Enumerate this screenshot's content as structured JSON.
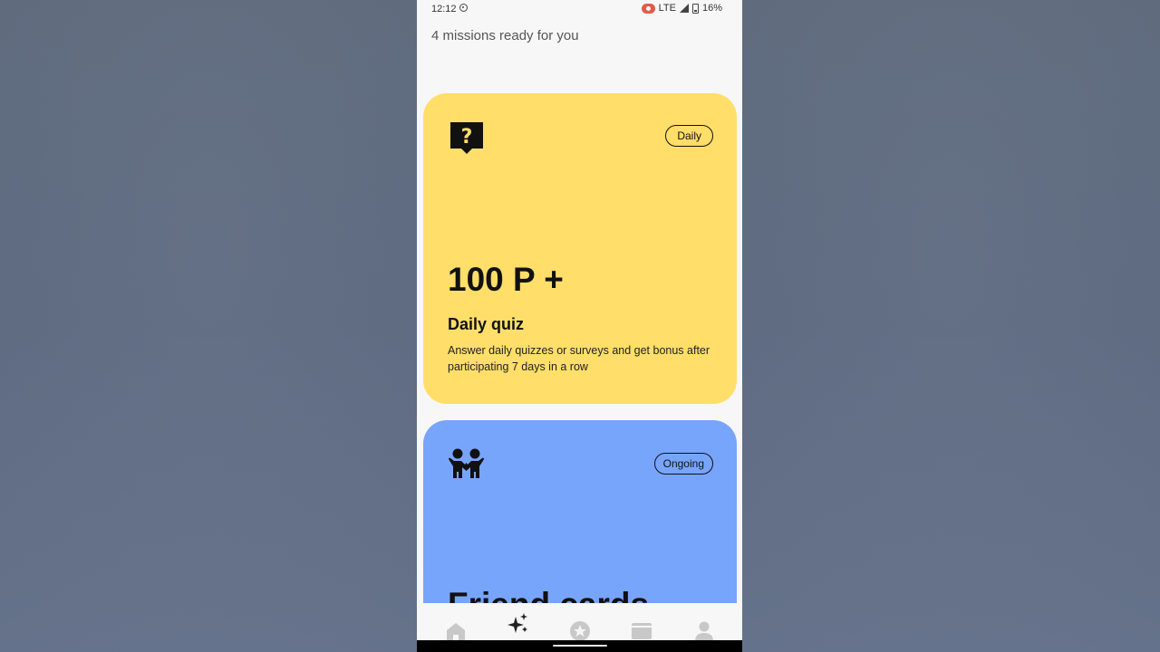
{
  "status_bar": {
    "time": "12:12",
    "network": "LTE",
    "battery": "16%"
  },
  "header": {
    "subtitle": "4 missions ready for you"
  },
  "missions": [
    {
      "badge": "Daily",
      "points": "100 P +",
      "title": "Daily quiz",
      "description": "Answer daily quizzes or surveys and get bonus after participating 7 days in a row",
      "icon": "quiz-question-icon",
      "color": "#ffde69"
    },
    {
      "badge": "Ongoing",
      "title": "Friend cards",
      "icon": "friends-icon",
      "color": "#78a5fc"
    }
  ],
  "bottom_nav": {
    "items": [
      {
        "icon": "home-icon"
      },
      {
        "icon": "sparkle-icon",
        "active": true
      },
      {
        "icon": "star-badge-icon"
      },
      {
        "icon": "wallet-icon"
      },
      {
        "icon": "profile-icon"
      }
    ]
  }
}
